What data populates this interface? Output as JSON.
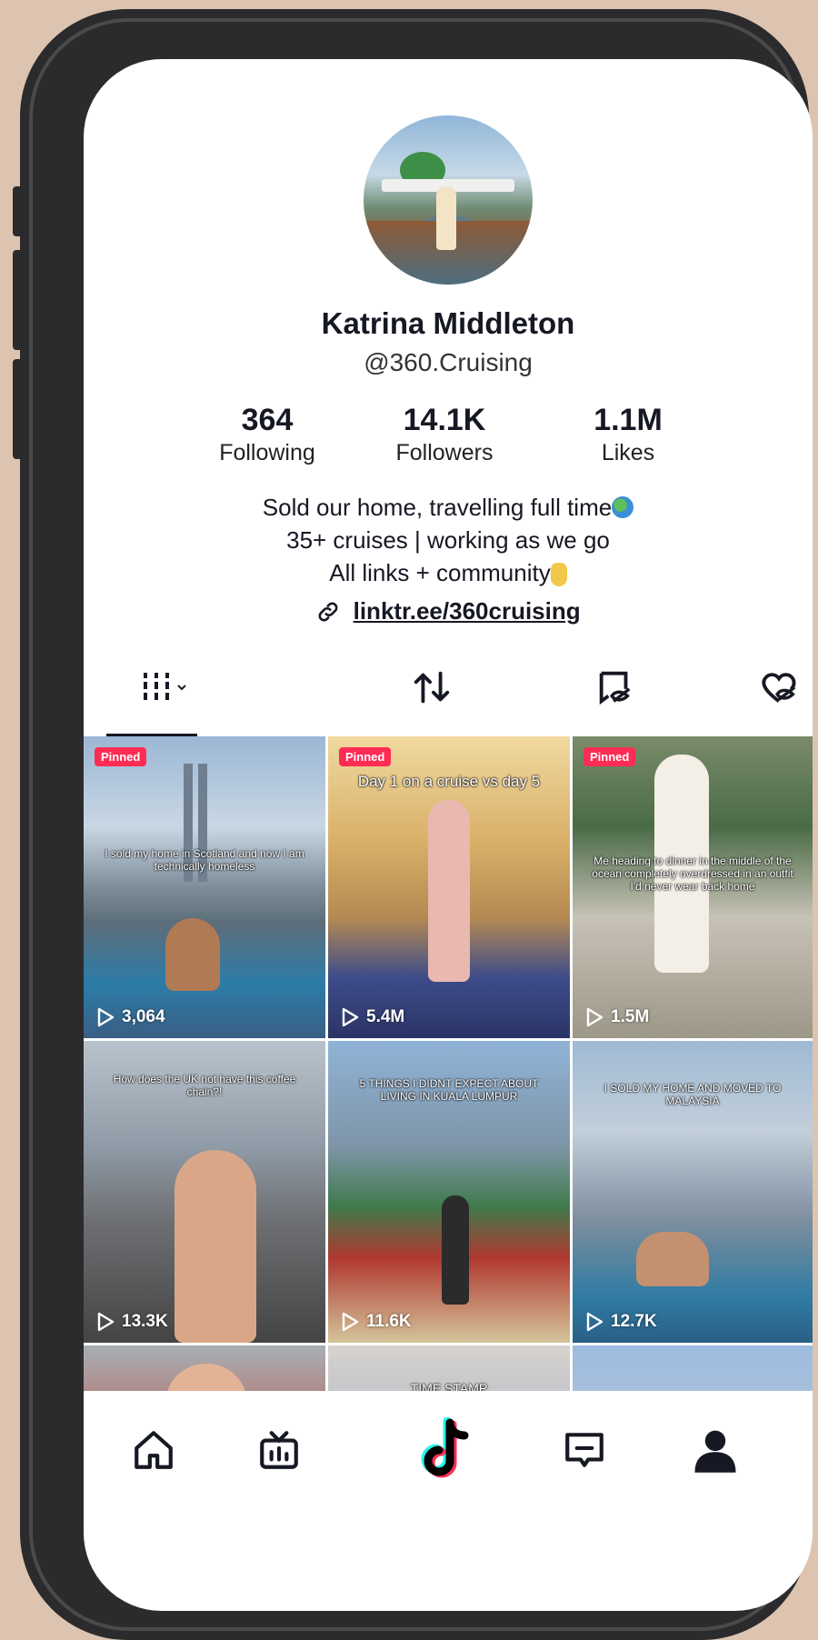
{
  "profile": {
    "name": "Katrina Middleton",
    "handle": "@360.Cruising",
    "stats": [
      {
        "value": "364",
        "label": "Following"
      },
      {
        "value": "14.1K",
        "label": "Followers"
      },
      {
        "value": "1.1M",
        "label": "Likes"
      }
    ],
    "bio_lines": [
      "Sold our home, travelling full time",
      "35+ cruises | working as we go",
      "All links + community"
    ],
    "link": "linktr.ee/360cruising"
  },
  "tabs": [
    {
      "name": "videos",
      "icon": "grid-icon"
    },
    {
      "name": "reposts",
      "icon": "repost-icon"
    },
    {
      "name": "private",
      "icon": "eye-off-icon"
    },
    {
      "name": "liked",
      "icon": "heart-off-icon"
    }
  ],
  "videos": [
    {
      "pinned": "Pinned",
      "caption": "I sold my home in Scotland and now I am technically homeless",
      "views": "3,064"
    },
    {
      "pinned": "Pinned",
      "caption": "Day 1 on a cruise vs day 5",
      "views": "5.4M"
    },
    {
      "pinned": "Pinned",
      "caption": "Me heading to dinner in the middle of the ocean completely overdressed in an outfit I'd never wear back home",
      "views": "1.5M"
    },
    {
      "pinned": "",
      "caption": "How does the UK not have this coffee chain?!",
      "views": "13.3K"
    },
    {
      "pinned": "",
      "caption": "5 THINGS I DIDNT EXPECT ABOUT LIVING IN KUALA LUMPUR",
      "views": "11.6K"
    },
    {
      "pinned": "",
      "caption": "I SOLD MY HOME AND MOVED TO MALAYSIA",
      "views": "12.7K"
    },
    {
      "pinned": "",
      "caption": "",
      "views": ""
    },
    {
      "pinned": "",
      "caption": "TIME STAMP",
      "views": ""
    },
    {
      "pinned": "",
      "caption": "",
      "views": ""
    }
  ],
  "nav": [
    {
      "name": "home",
      "icon": "home-icon"
    },
    {
      "name": "tv",
      "icon": "tv-icon"
    },
    {
      "name": "tiktok",
      "icon": "tiktok-logo-icon"
    },
    {
      "name": "inbox",
      "icon": "inbox-icon"
    },
    {
      "name": "profile",
      "icon": "profile-icon"
    }
  ],
  "colors": {
    "accent": "#fe2c55",
    "text": "#161823",
    "background": "#dcc4b0",
    "frame": "#2b2b2d"
  }
}
